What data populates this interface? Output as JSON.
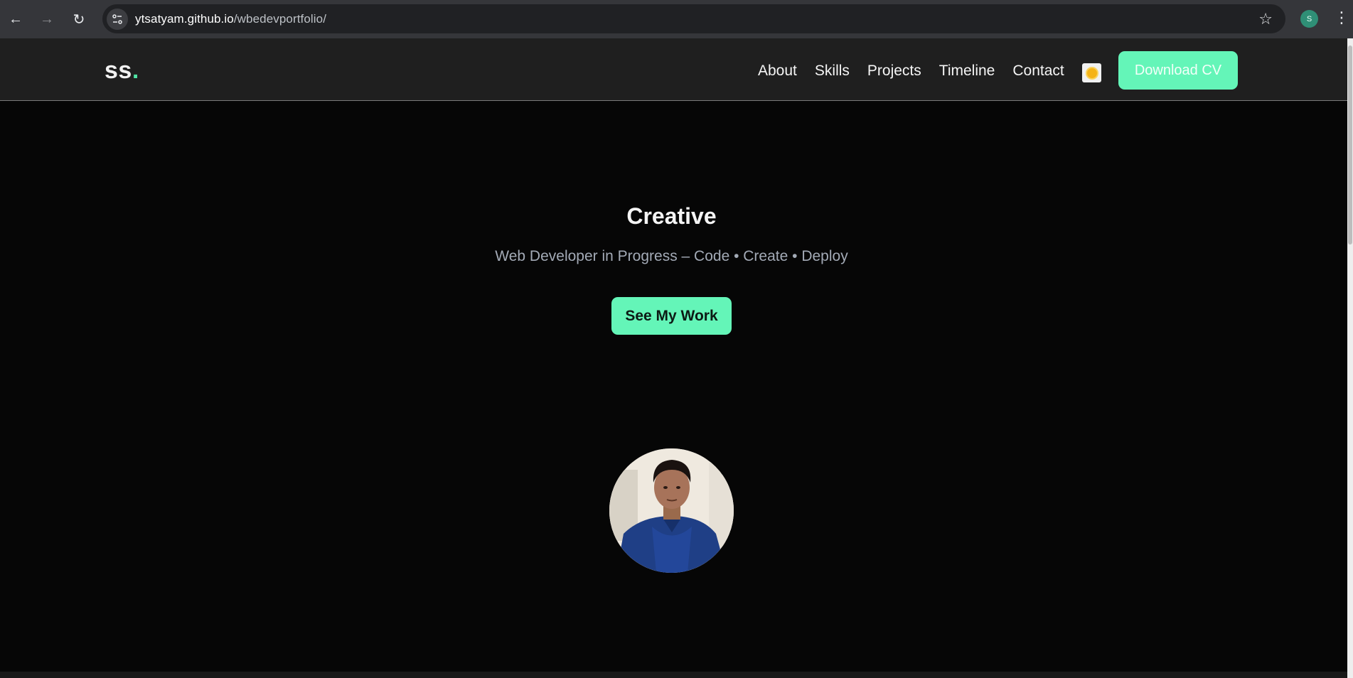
{
  "browser": {
    "back_icon": "←",
    "forward_icon": "→",
    "reload_icon": "↻",
    "url_host": "ytsatyam.github.io",
    "url_path": "/wbedevportfolio/",
    "star_icon": "☆",
    "profile_initial": "S",
    "menu_icon": "⋮"
  },
  "header": {
    "logo_text": "ss",
    "logo_dot": ".",
    "nav": [
      "About",
      "Skills",
      "Projects",
      "Timeline",
      "Contact"
    ],
    "download_label": "Download CV"
  },
  "hero": {
    "title": "Creative",
    "subtitle": "Web Developer in Progress – Code • Create • Deploy",
    "cta_label": "See My Work"
  },
  "colors": {
    "accent": "#64f5b8",
    "background": "#060606",
    "header_bg": "#1f1f1f"
  }
}
